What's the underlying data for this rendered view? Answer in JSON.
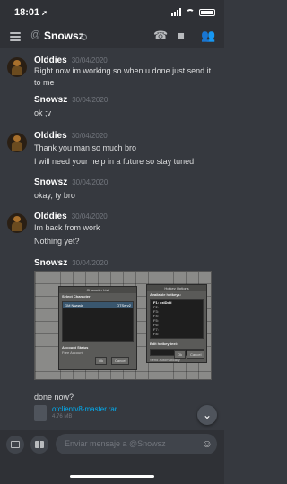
{
  "status_bar": {
    "time": "18:01"
  },
  "header": {
    "username": "Snowsz"
  },
  "messages": [
    {
      "author": "Olddies",
      "date": "30/04/2020",
      "lines": [
        "Right now im working so when u done just send it",
        "to me"
      ]
    },
    {
      "author": "Snowsz",
      "date": "30/04/2020",
      "lines": [
        "ok ;v"
      ]
    },
    {
      "author": "Olddies",
      "date": "30/04/2020",
      "lines": [
        "Thank you man so much bro",
        "I will need your help in a future so stay tuned"
      ]
    },
    {
      "author": "Snowsz",
      "date": "30/04/2020",
      "lines": [
        "okay, ty bro"
      ]
    },
    {
      "author": "Olddies",
      "date": "30/04/2020",
      "lines": [
        "Im back from work",
        "Nothing yet?"
      ]
    },
    {
      "author": "Snowsz",
      "date": "30/04/2020",
      "lines": [
        "done now?"
      ]
    }
  ],
  "screenshot_attachment": {
    "character_list": {
      "title": "Character List",
      "select_label": "Select Character:",
      "character": "GM Nwgala",
      "server": "OTServ2",
      "account_status_label": "Account Status",
      "account_status_value": "Free Account",
      "ok_label": "Ok",
      "cancel_label": "Cancel"
    },
    "hotkey_options": {
      "title": "Hotkey Options",
      "available_label": "Available hotkeys:",
      "hotkeys": [
        "F1: exiDdd",
        "F2:",
        "F3:",
        "F4:",
        "F5:",
        "F6:",
        "F7:",
        "F8:"
      ],
      "edit_label": "Edit hotkey text:",
      "send_label": "Send automatically",
      "ok_label": "Ok",
      "cancel_label": "Cancel"
    }
  },
  "file_attachment": {
    "name": "otclientv8-master.rar",
    "size": "4.76 MB"
  },
  "composer": {
    "placeholder": "Enviar mensaje a @Snowsz"
  }
}
